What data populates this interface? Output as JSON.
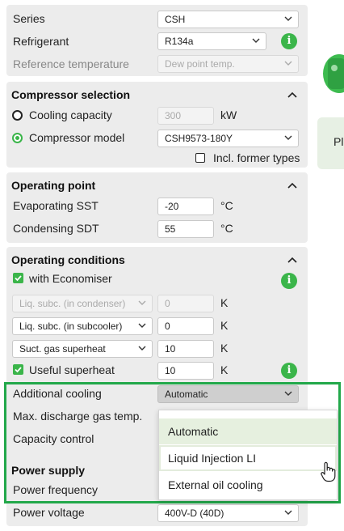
{
  "top": {
    "series_label": "Series",
    "series_value": "CSH",
    "refrigerant_label": "Refrigerant",
    "refrigerant_value": "R134a",
    "reftemp_label": "Reference temperature",
    "reftemp_value": "Dew point temp."
  },
  "compressor_selection": {
    "title": "Compressor selection",
    "cooling_capacity_label": "Cooling capacity",
    "cooling_capacity_value": "300",
    "cooling_capacity_unit": "kW",
    "compressor_model_label": "Compressor model",
    "compressor_model_value": "CSH9573-180Y",
    "incl_former_label": "Incl. former types"
  },
  "operating_point": {
    "title": "Operating point",
    "evap_label": "Evaporating SST",
    "evap_value": "-20",
    "evap_unit": "°C",
    "cond_label": "Condensing SDT",
    "cond_value": "55",
    "cond_unit": "°C"
  },
  "operating_conditions": {
    "title": "Operating conditions",
    "economiser_label": "with Economiser",
    "liq_cond_label": "Liq. subc. (in condenser)",
    "liq_cond_value": "0",
    "liq_cond_unit": "K",
    "liq_sub_label": "Liq. subc. (in subcooler)",
    "liq_sub_value": "0",
    "liq_sub_unit": "K",
    "suct_label": "Suct. gas superheat",
    "suct_value": "10",
    "suct_unit": "K",
    "useful_label": "Useful superheat",
    "useful_value": "10",
    "useful_unit": "K",
    "additional_cooling_label": "Additional cooling",
    "additional_cooling_value": "Automatic",
    "max_discharge_label": "Max. discharge gas temp.",
    "capacity_control_label": "Capacity control"
  },
  "power_supply": {
    "title": "Power supply",
    "frequency_label": "Power frequency",
    "voltage_label": "Power voltage",
    "voltage_value": "400V-D (40D)"
  },
  "dropdown": {
    "options": [
      "Automatic",
      "Liquid Injection LI",
      "External oil cooling"
    ]
  },
  "side": {
    "card_text": "Pl"
  },
  "colors": {
    "accent": "#3bb54a",
    "frame": "#22a84a",
    "panel": "#ececec"
  }
}
